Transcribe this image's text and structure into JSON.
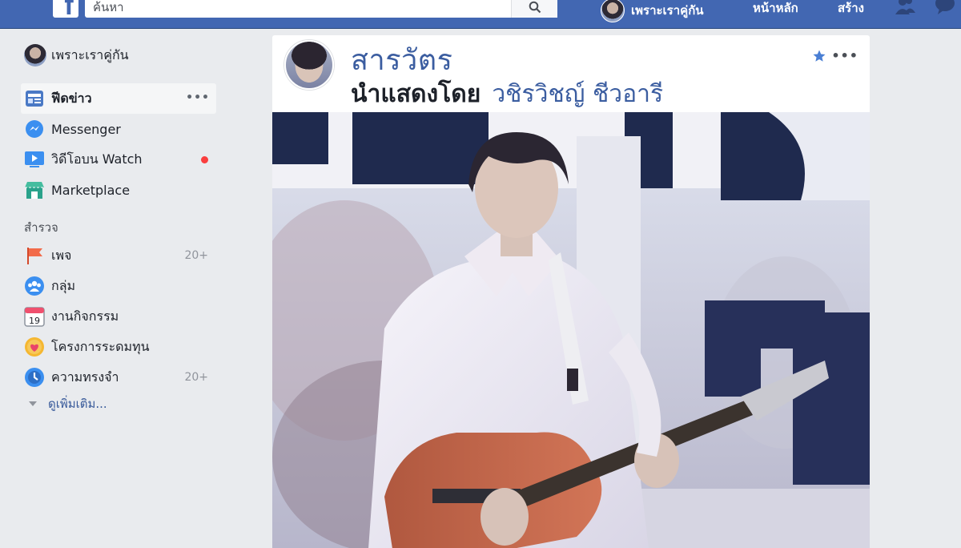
{
  "topbar": {
    "search_placeholder": "ค้นหา",
    "profile_name": "เพราะเราคู่กัน",
    "home_label": "หน้าหลัก",
    "create_label": "สร้าง",
    "brand_color": "#4267b2"
  },
  "sidebar": {
    "profile_name": "เพราะเราคู่กัน",
    "items": [
      {
        "label": "ฟีดข่าว",
        "icon": "news-feed-icon",
        "active": true
      },
      {
        "label": "Messenger",
        "icon": "messenger-icon"
      },
      {
        "label": "วิดีโอบน Watch",
        "icon": "watch-icon",
        "has_dot": true
      },
      {
        "label": "Marketplace",
        "icon": "marketplace-icon"
      }
    ],
    "explore_heading": "สำรวจ",
    "explore_items": [
      {
        "label": "เพจ",
        "icon": "flag-icon",
        "count": "20+"
      },
      {
        "label": "กลุ่ม",
        "icon": "groups-icon",
        "count": ""
      },
      {
        "label": "งานกิจกรรม",
        "icon": "calendar-icon",
        "count": "",
        "calendar_day": "19"
      },
      {
        "label": "โครงการระดมทุน",
        "icon": "fundraiser-icon",
        "count": ""
      },
      {
        "label": "ความทรงจำ",
        "icon": "memories-icon",
        "count": "20+"
      }
    ],
    "see_more": "ดูเพิ่มเติม..."
  },
  "post": {
    "title": "สารวัตร",
    "sub_prefix": "นำแสดงโดย",
    "actor": "วชิรวิชญ์ ชีวอารี",
    "accent_color": "#3b5da0"
  }
}
